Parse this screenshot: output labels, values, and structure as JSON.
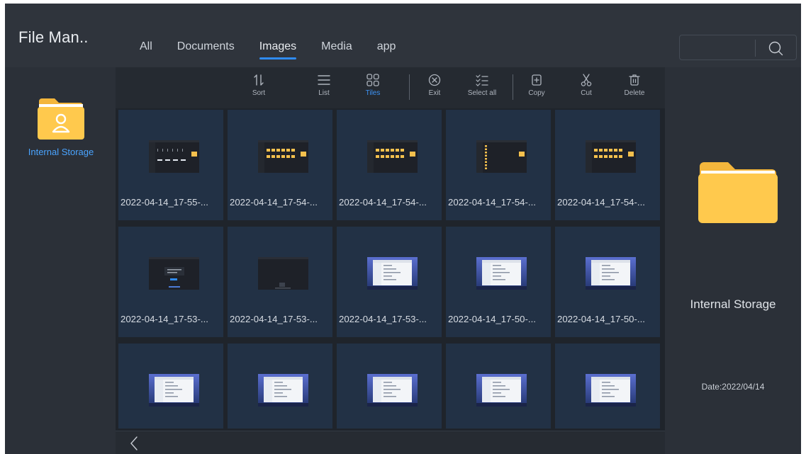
{
  "app": {
    "title": "File Man.."
  },
  "tabs": [
    {
      "label": "All",
      "active": false
    },
    {
      "label": "Documents",
      "active": false
    },
    {
      "label": "Images",
      "active": true
    },
    {
      "label": "Media",
      "active": false
    },
    {
      "label": "app",
      "active": false
    }
  ],
  "search": {
    "icon": "search-icon"
  },
  "sidebar": {
    "storage_label": "Internal Storage",
    "icon": "user-folder-icon"
  },
  "toolbar": {
    "sort": "Sort",
    "list": "List",
    "tiles": "Tiles",
    "exit": "Exit",
    "select_all": "Select all",
    "copy": "Copy",
    "cut": "Cut",
    "delete": "Delete"
  },
  "files": [
    {
      "name": "2022-04-14_17-55-...",
      "thumb": "dark"
    },
    {
      "name": "2022-04-14_17-54-...",
      "thumb": "dark-folders"
    },
    {
      "name": "2022-04-14_17-54-...",
      "thumb": "dark-folders"
    },
    {
      "name": "2022-04-14_17-54-...",
      "thumb": "dark-list"
    },
    {
      "name": "2022-04-14_17-54-...",
      "thumb": "dark-folders"
    },
    {
      "name": "2022-04-14_17-53-...",
      "thumb": "dark-dialog"
    },
    {
      "name": "2022-04-14_17-53-...",
      "thumb": "dark-plain"
    },
    {
      "name": "2022-04-14_17-53-...",
      "thumb": "desktop"
    },
    {
      "name": "2022-04-14_17-50-...",
      "thumb": "desktop"
    },
    {
      "name": "2022-04-14_17-50-...",
      "thumb": "desktop"
    },
    {
      "name": "",
      "thumb": "desktop"
    },
    {
      "name": "",
      "thumb": "desktop"
    },
    {
      "name": "",
      "thumb": "desktop"
    },
    {
      "name": "",
      "thumb": "desktop"
    },
    {
      "name": "",
      "thumb": "desktop"
    }
  ],
  "detail": {
    "name": "Internal Storage",
    "date": "Date:2022/04/14"
  },
  "colors": {
    "accent": "#2f8bf3",
    "folder": "#ffc94d",
    "tile": "#223145"
  }
}
